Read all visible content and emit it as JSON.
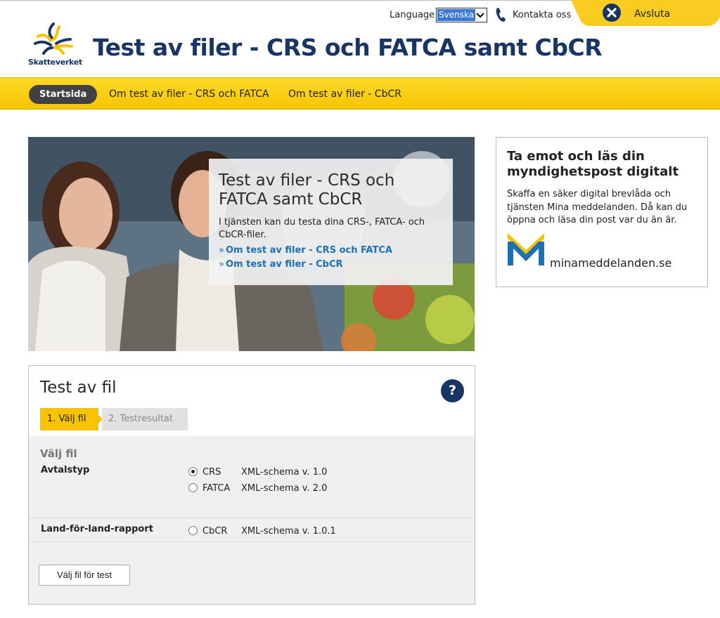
{
  "header": {
    "language_label": "Language",
    "language_selected": "Svenska",
    "contact_label": "Kontakta oss",
    "exit_label": "Avsluta",
    "logo_text": "Skatteverket",
    "site_title": "Test av filer - CRS och FATCA samt CbCR"
  },
  "nav": {
    "items": [
      {
        "label": "Startsida"
      },
      {
        "label": "Om test av filer - CRS och FATCA"
      },
      {
        "label": "Om test av filer - CbCR"
      }
    ]
  },
  "hero": {
    "title": "Test av filer - CRS och FATCA samt CbCR",
    "description": "I tjänsten kan du testa dina CRS-, FATCA- och CbCR-filer.",
    "links": [
      {
        "label": "Om test av filer - CRS och FATCA"
      },
      {
        "label": "Om test av filer - CbCR"
      }
    ]
  },
  "side": {
    "title": "Ta emot och läs din myndighetspost digitalt",
    "text": "Skaffa en säker digital brevlåda och tjänsten Mina meddelanden. Då kan du öppna och läsa din post var du än är.",
    "brand": "minameddelanden.se"
  },
  "panel": {
    "title": "Test av fil",
    "help": "?",
    "steps": [
      {
        "label": "1. Välj fil"
      },
      {
        "label": "2. Testresultat"
      }
    ],
    "section_title": "Välj fil",
    "agreement_label": "Avtalstyp",
    "options": [
      {
        "label": "CRS",
        "schema": "XML-schema v. 1.0",
        "checked": true
      },
      {
        "label": "FATCA",
        "schema": "XML-schema v. 2.0",
        "checked": false
      }
    ],
    "cbcr_label": "Land-för-land-rapport",
    "cbcr_option": {
      "label": "CbCR",
      "schema": "XML-schema v. 1.0.1",
      "checked": false
    },
    "button_label": "Välj fil för test"
  },
  "colors": {
    "brand_yellow": "#f7c300",
    "brand_navy": "#193566",
    "link_blue": "#1e6fb3"
  }
}
